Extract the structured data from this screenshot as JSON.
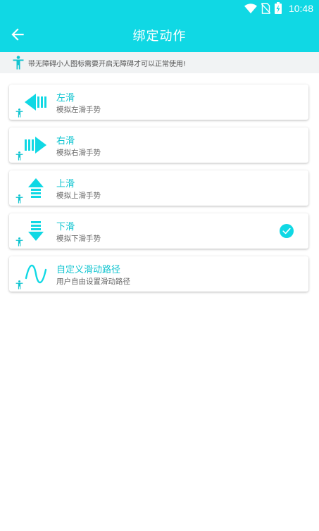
{
  "status_bar": {
    "time": "10:48",
    "icons": [
      "wifi-icon",
      "no-sim-icon",
      "battery-charging-icon"
    ]
  },
  "app_bar": {
    "title": "绑定动作",
    "back_icon": "arrow-left-icon"
  },
  "notice": {
    "text": "带无障碍小人图标需要开启无障碍才可以正常使用!",
    "icon": "accessibility-person-icon"
  },
  "actions": [
    {
      "title": "左滑",
      "subtitle": "模拟左滑手势",
      "icon": "swipe-left-icon",
      "selected": false
    },
    {
      "title": "右滑",
      "subtitle": "模拟右滑手势",
      "icon": "swipe-right-icon",
      "selected": false
    },
    {
      "title": "上滑",
      "subtitle": "模拟上滑手势",
      "icon": "swipe-up-icon",
      "selected": false
    },
    {
      "title": "下滑",
      "subtitle": "模拟下滑手势",
      "icon": "swipe-down-icon",
      "selected": true
    },
    {
      "title": "自定义滑动路径",
      "subtitle": "用户自由设置滑动路径",
      "icon": "custom-path-icon",
      "selected": false
    }
  ],
  "colors": {
    "accent": "#10d8e4",
    "title_text": "#10c4d0",
    "subtitle_text": "#666666",
    "notice_bg": "#f1f3f4"
  }
}
